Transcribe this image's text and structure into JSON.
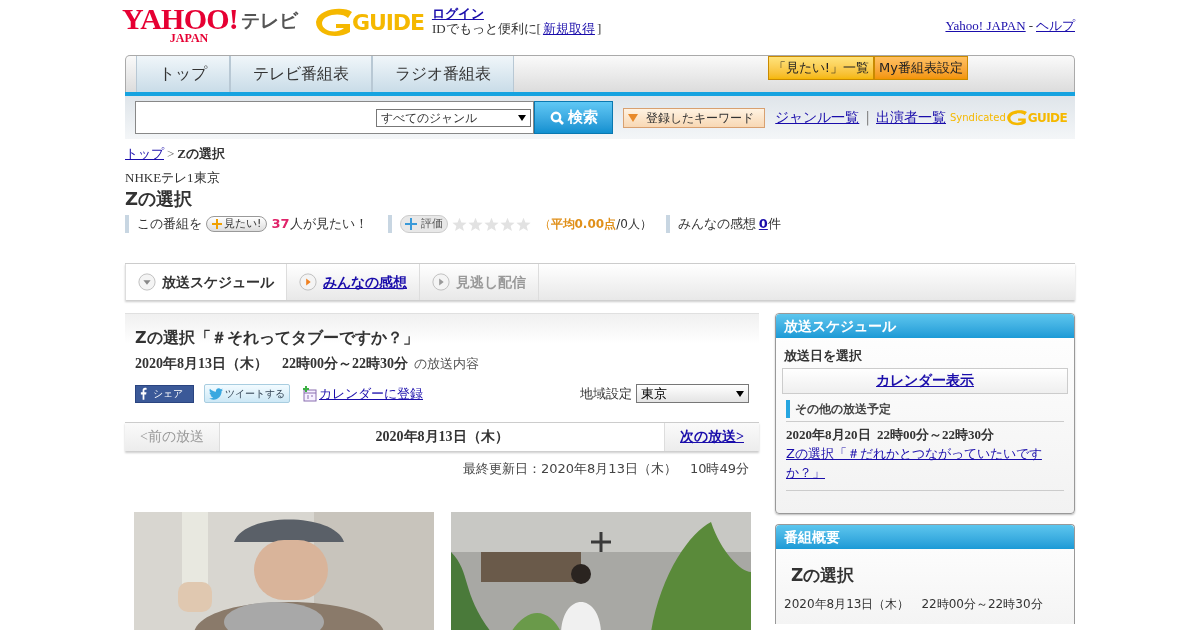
{
  "header": {
    "logo_main": "YAHOO!",
    "logo_sub": "JAPAN",
    "logo_service": "テレビ",
    "guide_logo": "GUIDE",
    "login_link": "ログイン",
    "login_note": "IDでもっと便利に[",
    "signup_link": "新規取得",
    "login_note_end": "]",
    "top_links": [
      "Yahoo! JAPAN",
      "ヘルプ"
    ],
    "top_sep": "-"
  },
  "nav": {
    "tabs": [
      {
        "label": "トップ"
      },
      {
        "label": "テレビ番組表"
      },
      {
        "label": "ラジオ番組表"
      }
    ],
    "buttons": [
      {
        "label": "「見たい!」一覧",
        "kind": "yellow"
      },
      {
        "label": "My番組表設定",
        "kind": "orange"
      }
    ]
  },
  "search": {
    "genre": "すべてのジャンル",
    "button": "検索",
    "keyword_button": "登録したキーワード",
    "links": [
      "ジャンル一覧",
      "出演者一覧"
    ],
    "link_sep": "|",
    "syndicated": "Syndicated",
    "guide_logo": "GUIDE"
  },
  "breadcrumb": {
    "home": "トップ",
    "sep": ">",
    "current": "Zの選択"
  },
  "program": {
    "channel": "NHKEテレ1東京",
    "title": "Zの選択",
    "want_prefix": "この番組を",
    "want_button": "見たい!",
    "want_count": "37",
    "want_suffix": "人が見たい！",
    "rate_button": "評価",
    "stars": 0,
    "rating_open": "（",
    "rating_avg": "平均0.00点",
    "rating_count": "/0人）",
    "reviews_label": "みんなの感想",
    "reviews_count": "0",
    "reviews_unit": "件"
  },
  "content_tabs": [
    {
      "label": "放送スケジュール",
      "selected": true,
      "disabled": false
    },
    {
      "label": "みんなの感想",
      "selected": false,
      "disabled": false
    },
    {
      "label": "見逃し配信",
      "selected": false,
      "disabled": true
    }
  ],
  "episode": {
    "title": "Zの選択「＃それってタブーですか？」",
    "datetime": "2020年8月13日（木）　22時00分～22時30分",
    "datetime_suffix": "の放送内容",
    "share": "シェア",
    "tweet": "ツイートする",
    "calendar": "カレンダーに登録",
    "region_label": "地域設定",
    "region": "東京"
  },
  "pager": {
    "prev": "<前の放送",
    "date": "2020年8月13日（木）",
    "next": "次の放送>",
    "prev_disabled": true
  },
  "updated": "最終更新日：2020年8月13日（木）　10時49分",
  "sidebar": {
    "schedule_title": "放送スケジュール",
    "select_label": "放送日を選択",
    "calendar_link": "カレンダー表示",
    "other_label": "その他の放送予定",
    "other": [
      {
        "datetime": "2020年8月20日  22時00分～22時30分",
        "title": "Zの選択「＃だれかとつながっていたいですか？」"
      }
    ],
    "summary_title": "番組概要",
    "summary_name": "Zの選択",
    "summary_datetime": "2020年8月13日（木）　22時00分～22時30分"
  }
}
